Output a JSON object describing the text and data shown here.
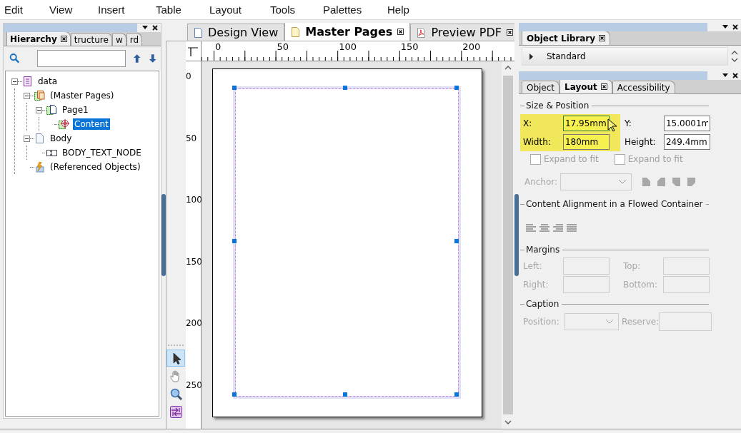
{
  "menu": [
    "Edit",
    "View",
    "Insert",
    "Table",
    "Layout",
    "Tools",
    "Palettes",
    "Help"
  ],
  "left_panel": {
    "tabs": [
      {
        "label": "Hierarchy",
        "selected": true,
        "closable": true
      },
      {
        "label": "tructure",
        "selected": false,
        "closable": false
      },
      {
        "label": "w",
        "selected": false,
        "closable": false
      },
      {
        "label": "rd",
        "selected": false,
        "closable": false
      }
    ],
    "tree": [
      {
        "label": "data",
        "kind": "data",
        "expanded": true,
        "selected": false,
        "children": [
          {
            "label": "(Master Pages)",
            "kind": "master",
            "expanded": true,
            "selected": false,
            "children": [
              {
                "label": "Page1",
                "kind": "page",
                "expanded": true,
                "selected": false,
                "children": [
                  {
                    "label": "Content",
                    "kind": "content",
                    "selected": true
                  }
                ]
              }
            ]
          },
          {
            "label": "Body",
            "kind": "body",
            "expanded": true,
            "selected": false,
            "children": [
              {
                "label": "BODY_TEXT_NODE",
                "kind": "text",
                "selected": false
              }
            ]
          },
          {
            "label": "(Referenced Objects)",
            "kind": "refs",
            "selected": false
          }
        ]
      }
    ]
  },
  "editor_tabs": [
    {
      "label": "Design View",
      "selected": false,
      "kind": "design",
      "closable": false
    },
    {
      "label": "Master Pages",
      "selected": true,
      "kind": "master",
      "closable": true
    },
    {
      "label": "Preview PDF",
      "selected": false,
      "kind": "pdf",
      "closable": true
    }
  ],
  "rulers": {
    "horizontal": [
      "0",
      "50",
      "100",
      "150",
      "200"
    ],
    "vertical": [
      "0",
      "50",
      "100",
      "150",
      "200",
      "250"
    ]
  },
  "tools": [
    {
      "kind": "pointer",
      "selected": true
    },
    {
      "kind": "hand",
      "selected": false
    },
    {
      "kind": "zoom",
      "selected": false
    },
    {
      "kind": "flow",
      "selected": false
    }
  ],
  "object_library": {
    "title": "Object Library",
    "groups": [
      {
        "label": "Standard",
        "expanded": false
      }
    ]
  },
  "properties": {
    "tabs": [
      {
        "label": "Object",
        "selected": false,
        "closable": false
      },
      {
        "label": "Layout",
        "selected": true,
        "closable": true
      },
      {
        "label": "Accessibility",
        "selected": false,
        "closable": false
      }
    ],
    "size_position": {
      "title": "Size & Position",
      "fields": [
        {
          "label": "X:",
          "value": "17.95mm",
          "highlighted": true,
          "disabled": false
        },
        {
          "label": "Y:",
          "value": "15.0001m",
          "highlighted": false,
          "disabled": false
        },
        {
          "label": "Width:",
          "value": "180mm",
          "highlighted": true,
          "disabled": false
        },
        {
          "label": "Height:",
          "value": "249.4mm",
          "highlighted": false,
          "disabled": false
        }
      ],
      "checkboxes": [
        {
          "label": "Expand to fit",
          "checked": false,
          "disabled": true
        },
        {
          "label": "Expand to fit",
          "checked": false,
          "disabled": true
        }
      ],
      "anchor": {
        "label": "Anchor:",
        "disabled": true
      }
    },
    "alignment": {
      "title": "Content Alignment in a Flowed Container",
      "disabled": true
    },
    "margins": {
      "title": "Margins",
      "fields": [
        {
          "label": "Left:",
          "disabled": true
        },
        {
          "label": "Top:",
          "disabled": true
        },
        {
          "label": "Right:",
          "disabled": true
        },
        {
          "label": "Bottom:",
          "disabled": true
        }
      ]
    },
    "caption": {
      "title": "Caption",
      "position": {
        "label": "Position:",
        "disabled": true
      },
      "reserve": {
        "label": "Reserve:",
        "disabled": true
      }
    }
  }
}
